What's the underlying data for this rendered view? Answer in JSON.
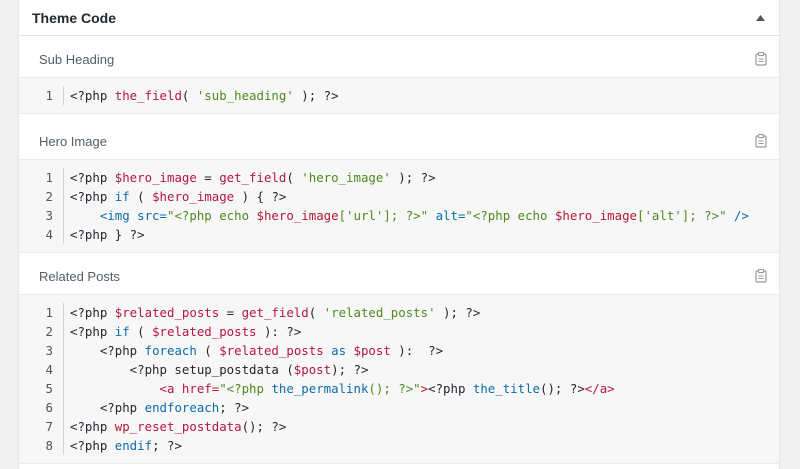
{
  "panel": {
    "title": "Theme Code"
  },
  "sections": [
    {
      "label": "Sub Heading",
      "lines": [
        {
          "n": "1",
          "tokens": [
            [
              "k",
              "<?php "
            ],
            [
              "fn",
              "the_field"
            ],
            [
              "k",
              "( "
            ],
            [
              "str",
              "'sub_heading'"
            ],
            [
              "k",
              " ); ?>"
            ]
          ]
        }
      ]
    },
    {
      "label": "Hero Image",
      "lines": [
        {
          "n": "1",
          "tokens": [
            [
              "k",
              "<?php "
            ],
            [
              "var",
              "$hero_image"
            ],
            [
              "k",
              " = "
            ],
            [
              "fn",
              "get_field"
            ],
            [
              "k",
              "( "
            ],
            [
              "str",
              "'hero_image'"
            ],
            [
              "k",
              " ); ?>"
            ]
          ]
        },
        {
          "n": "2",
          "tokens": [
            [
              "k",
              "<?php "
            ],
            [
              "kw",
              "if"
            ],
            [
              "k",
              " ( "
            ],
            [
              "var",
              "$hero_image"
            ],
            [
              "k",
              " ) { ?>"
            ]
          ]
        },
        {
          "n": "3",
          "tokens": [
            [
              "k",
              "    "
            ],
            [
              "kw",
              "<img src="
            ],
            [
              "str",
              "\"<?php echo "
            ],
            [
              "var",
              "$hero_image"
            ],
            [
              "str",
              "['url']; ?>\""
            ],
            [
              "kw",
              " alt="
            ],
            [
              "str",
              "\"<?php echo "
            ],
            [
              "var",
              "$hero_image"
            ],
            [
              "str",
              "['alt']; ?>\""
            ],
            [
              "kw",
              " />"
            ]
          ]
        },
        {
          "n": "4",
          "tokens": [
            [
              "k",
              "<?php } ?>"
            ]
          ]
        }
      ]
    },
    {
      "label": "Related Posts",
      "lines": [
        {
          "n": "1",
          "tokens": [
            [
              "k",
              "<?php "
            ],
            [
              "var",
              "$related_posts"
            ],
            [
              "k",
              " = "
            ],
            [
              "fn",
              "get_field"
            ],
            [
              "k",
              "( "
            ],
            [
              "str",
              "'related_posts'"
            ],
            [
              "k",
              " ); ?>"
            ]
          ]
        },
        {
          "n": "2",
          "tokens": [
            [
              "k",
              "<?php "
            ],
            [
              "kw",
              "if"
            ],
            [
              "k",
              " ( "
            ],
            [
              "var",
              "$related_posts"
            ],
            [
              "k",
              " ): ?>"
            ]
          ]
        },
        {
          "n": "3",
          "tokens": [
            [
              "k",
              "    <?php "
            ],
            [
              "kw",
              "foreach"
            ],
            [
              "k",
              " ( "
            ],
            [
              "var",
              "$related_posts"
            ],
            [
              "kw",
              " as "
            ],
            [
              "var",
              "$post"
            ],
            [
              "k",
              " ):  ?>"
            ]
          ]
        },
        {
          "n": "4",
          "tokens": [
            [
              "k",
              "        <?php setup_postdata ("
            ],
            [
              "var",
              "$post"
            ],
            [
              "k",
              "); ?>"
            ]
          ]
        },
        {
          "n": "5",
          "tokens": [
            [
              "k",
              "            "
            ],
            [
              "fn",
              "<a href="
            ],
            [
              "str",
              "\"<?php "
            ],
            [
              "kw",
              "the_permalink"
            ],
            [
              "str",
              "(); ?>\""
            ],
            [
              "fn",
              ">"
            ],
            [
              "k",
              "<?php "
            ],
            [
              "kw",
              "the_title"
            ],
            [
              "k",
              "(); ?>"
            ],
            [
              "fn",
              "</a>"
            ]
          ]
        },
        {
          "n": "6",
          "tokens": [
            [
              "k",
              "    <?php "
            ],
            [
              "kw",
              "endforeach"
            ],
            [
              "k",
              "; ?>"
            ]
          ]
        },
        {
          "n": "7",
          "tokens": [
            [
              "k",
              "<?php "
            ],
            [
              "fn",
              "wp_reset_postdata"
            ],
            [
              "k",
              "(); ?>"
            ]
          ]
        },
        {
          "n": "8",
          "tokens": [
            [
              "k",
              "<?php "
            ],
            [
              "kw",
              "endif"
            ],
            [
              "k",
              "; ?>"
            ]
          ]
        }
      ]
    }
  ],
  "icons": {
    "collapse": "triangle-up-icon",
    "copy": "clipboard-icon"
  }
}
